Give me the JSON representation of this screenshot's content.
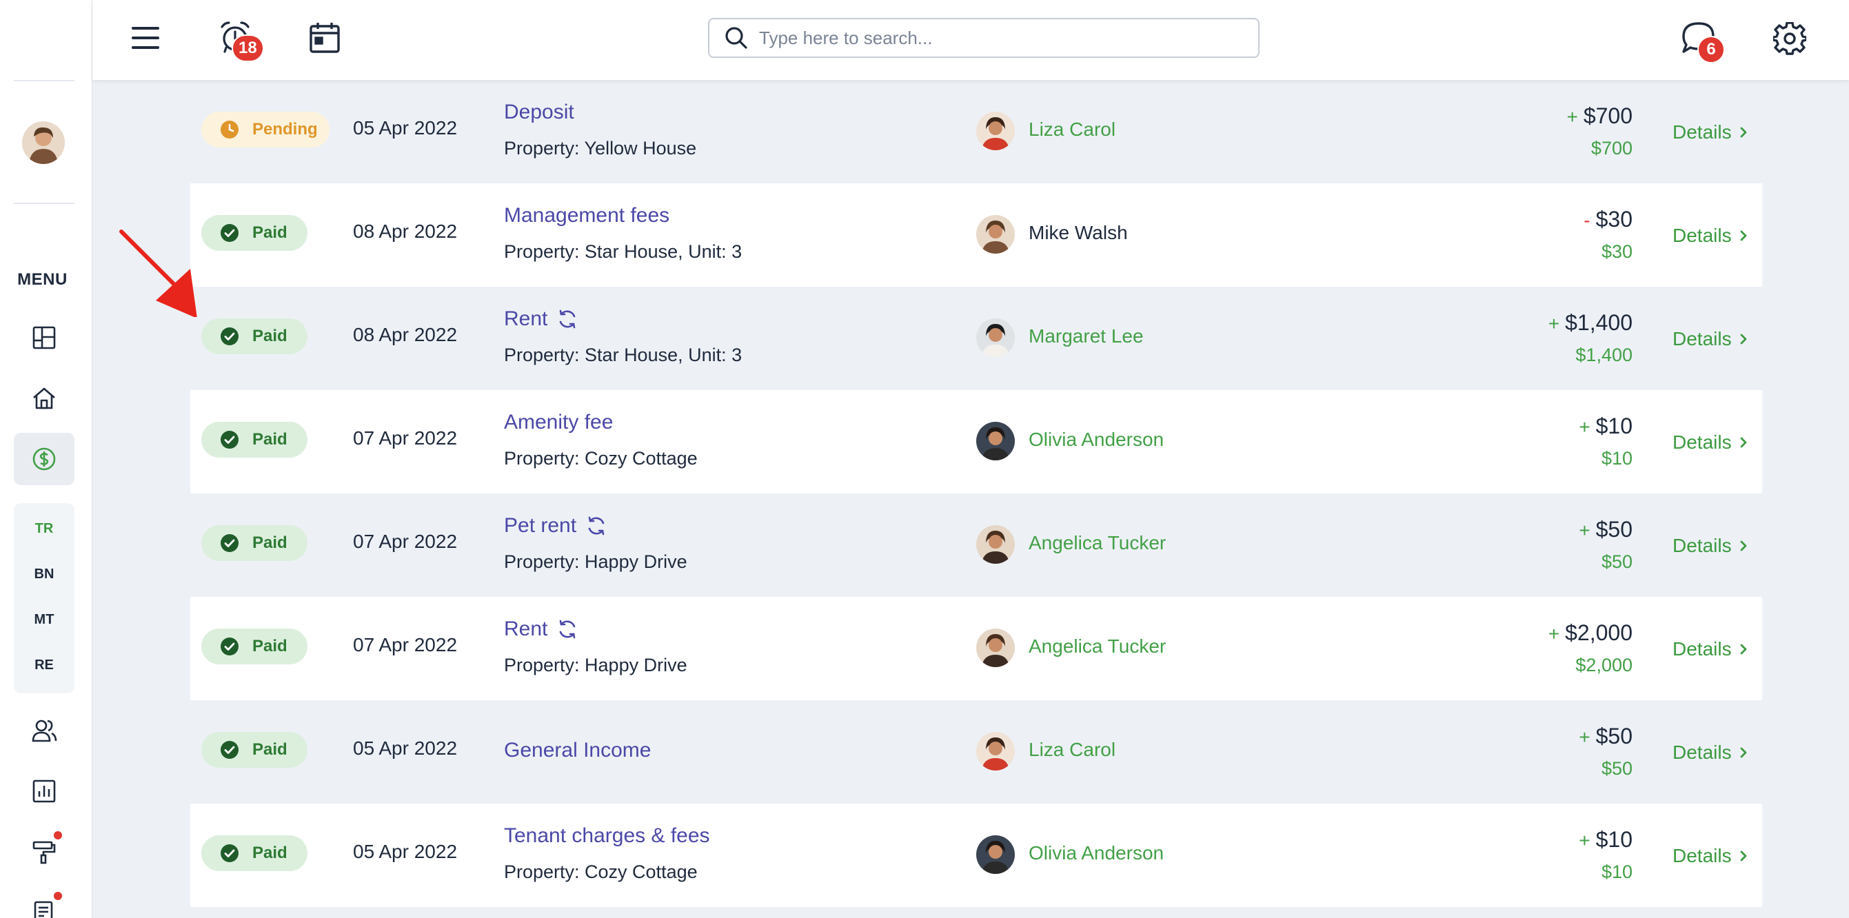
{
  "topbar": {
    "notifications_count": "18",
    "search_placeholder": "Type here to search...",
    "messages_count": "6"
  },
  "sidebar": {
    "menu_title": "MENU",
    "sub_items": [
      "TR",
      "BN",
      "MT",
      "RE"
    ]
  },
  "transactions": [
    {
      "status": "Pending",
      "date": "05 Apr 2022",
      "title": "Deposit",
      "recurring": false,
      "property": "Property: Yellow House",
      "person": "Liza Carol",
      "person_link": true,
      "sign": "+",
      "amount": "$700",
      "amount_sub": "$700",
      "details": "Details"
    },
    {
      "status": "Paid",
      "date": "08 Apr 2022",
      "title": "Management fees",
      "recurring": false,
      "property": "Property: Star House, Unit: 3",
      "person": "Mike Walsh",
      "person_link": false,
      "sign": "-",
      "amount": "$30",
      "amount_sub": "$30",
      "details": "Details"
    },
    {
      "status": "Paid",
      "date": "08 Apr 2022",
      "title": "Rent",
      "recurring": true,
      "property": "Property: Star House, Unit: 3",
      "person": "Margaret Lee",
      "person_link": true,
      "sign": "+",
      "amount": "$1,400",
      "amount_sub": "$1,400",
      "details": "Details"
    },
    {
      "status": "Paid",
      "date": "07 Apr 2022",
      "title": "Amenity fee",
      "recurring": false,
      "property": "Property: Cozy Cottage",
      "person": "Olivia Anderson",
      "person_link": true,
      "sign": "+",
      "amount": "$10",
      "amount_sub": "$10",
      "details": "Details"
    },
    {
      "status": "Paid",
      "date": "07 Apr 2022",
      "title": "Pet rent",
      "recurring": true,
      "property": "Property: Happy Drive",
      "person": "Angelica Tucker",
      "person_link": true,
      "sign": "+",
      "amount": "$50",
      "amount_sub": "$50",
      "details": "Details"
    },
    {
      "status": "Paid",
      "date": "07 Apr 2022",
      "title": "Rent",
      "recurring": true,
      "property": "Property: Happy Drive",
      "person": "Angelica Tucker",
      "person_link": true,
      "sign": "+",
      "amount": "$2,000",
      "amount_sub": "$2,000",
      "details": "Details"
    },
    {
      "status": "Paid",
      "date": "05 Apr 2022",
      "title": "General Income",
      "recurring": false,
      "property": "",
      "person": "Liza Carol",
      "person_link": true,
      "sign": "+",
      "amount": "$50",
      "amount_sub": "$50",
      "details": "Details"
    },
    {
      "status": "Paid",
      "date": "05 Apr 2022",
      "title": "Tenant charges & fees",
      "recurring": false,
      "property": "Property: Cozy Cottage",
      "person": "Olivia Anderson",
      "person_link": true,
      "sign": "+",
      "amount": "$10",
      "amount_sub": "$10",
      "details": "Details"
    }
  ],
  "colors": {
    "accent_green": "#43a047",
    "link_purple": "#4b48a8",
    "badge_red": "#e0372f",
    "pending_orange": "#e0962a"
  }
}
